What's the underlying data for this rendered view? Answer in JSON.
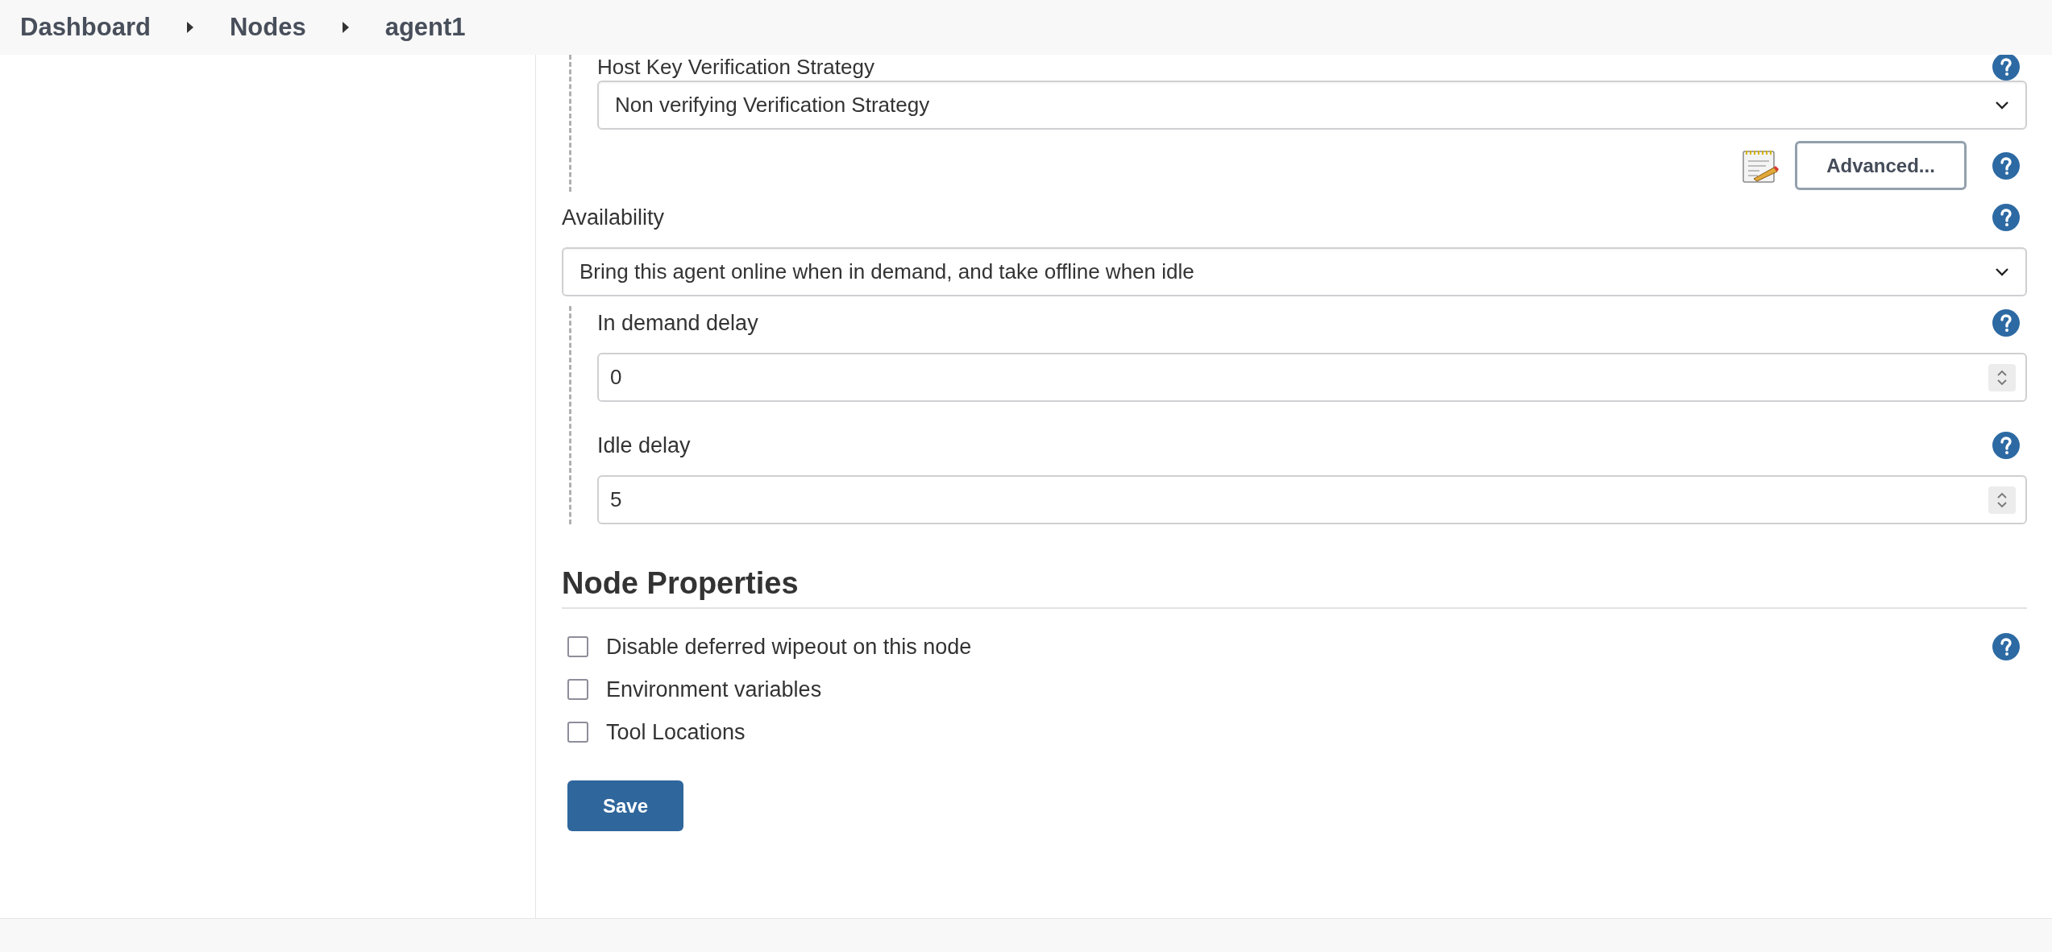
{
  "breadcrumbs": [
    {
      "label": "Dashboard"
    },
    {
      "label": "Nodes"
    },
    {
      "label": "agent1"
    }
  ],
  "host_key": {
    "label": "Host Key Verification Strategy",
    "value": "Non verifying Verification Strategy",
    "advanced_button": "Advanced..."
  },
  "availability": {
    "label": "Availability",
    "value": "Bring this agent online when in demand, and take offline when idle",
    "fields": [
      {
        "label": "In demand delay",
        "value": "0"
      },
      {
        "label": "Idle delay",
        "value": "5"
      }
    ]
  },
  "node_properties": {
    "title": "Node Properties",
    "options": [
      {
        "label": "Disable deferred wipeout on this node",
        "checked": false,
        "help": true
      },
      {
        "label": "Environment variables",
        "checked": false,
        "help": false
      },
      {
        "label": "Tool Locations",
        "checked": false,
        "help": false
      }
    ]
  },
  "save_button": "Save"
}
